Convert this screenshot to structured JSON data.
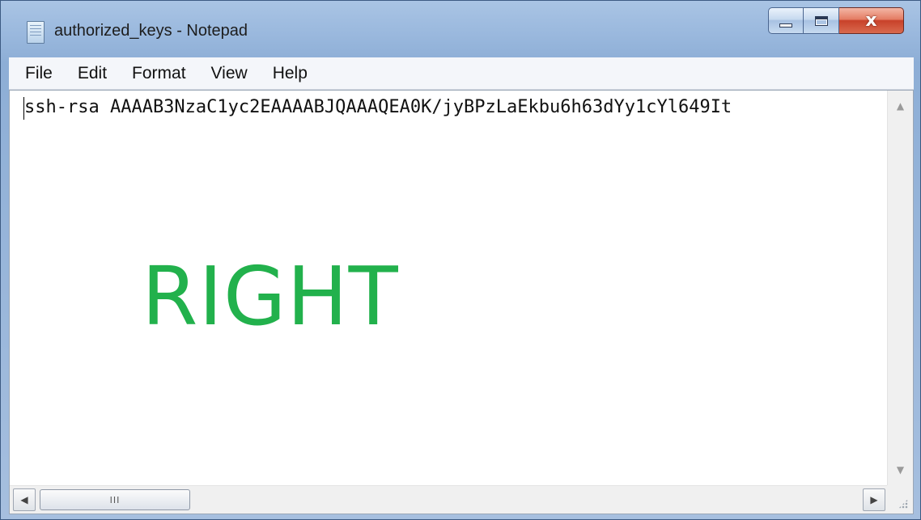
{
  "window": {
    "title": "authorized_keys - Notepad",
    "icon": "notepad-icon"
  },
  "caption_buttons": {
    "minimize_icon": "minimize-icon",
    "maximize_icon": "maximize-icon",
    "close_glyph": "x"
  },
  "menu": {
    "items": [
      "File",
      "Edit",
      "Format",
      "View",
      "Help"
    ]
  },
  "editor": {
    "line_1": "ssh-rsa AAAAB3NzaC1yc2EAAAABJQAAAQEA0K/jyBPzLaEkbu6h63dYy1cYl649It",
    "overlay_text": "RIGHT",
    "overlay_color": "#22b14c"
  },
  "scrollbars": {
    "hthumb_grip": "III"
  }
}
